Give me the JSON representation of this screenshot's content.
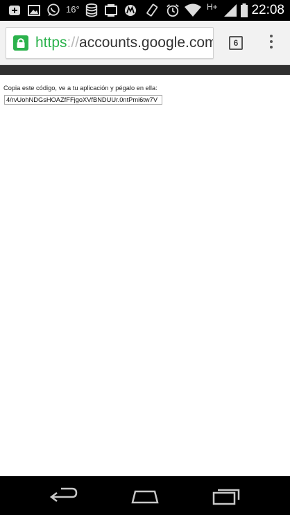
{
  "status_bar": {
    "temperature": "16°",
    "network": "H+",
    "clock": "22:08",
    "icons": [
      "add-notification-icon",
      "image-icon",
      "whatsapp-icon",
      "database-icon",
      "screen-icon",
      "motorola-icon",
      "rotate-icon",
      "alarm-icon",
      "wifi-icon",
      "signal-icon",
      "battery-icon"
    ]
  },
  "browser": {
    "url_scheme": "https",
    "url_sep": "://",
    "url_host": "accounts.google.com",
    "tab_count": "6",
    "accent_color": "#2bb24c"
  },
  "page": {
    "instruction": "Copia este código, ve a tu aplicación y pégalo en ella:",
    "code": "4/rvUohNDGsHOAZfFFjgoXVfBNDUUr.0ntPmi6tw7V"
  },
  "nav_bar": {
    "icons": [
      "back-icon",
      "home-icon",
      "recent-apps-icon"
    ]
  }
}
